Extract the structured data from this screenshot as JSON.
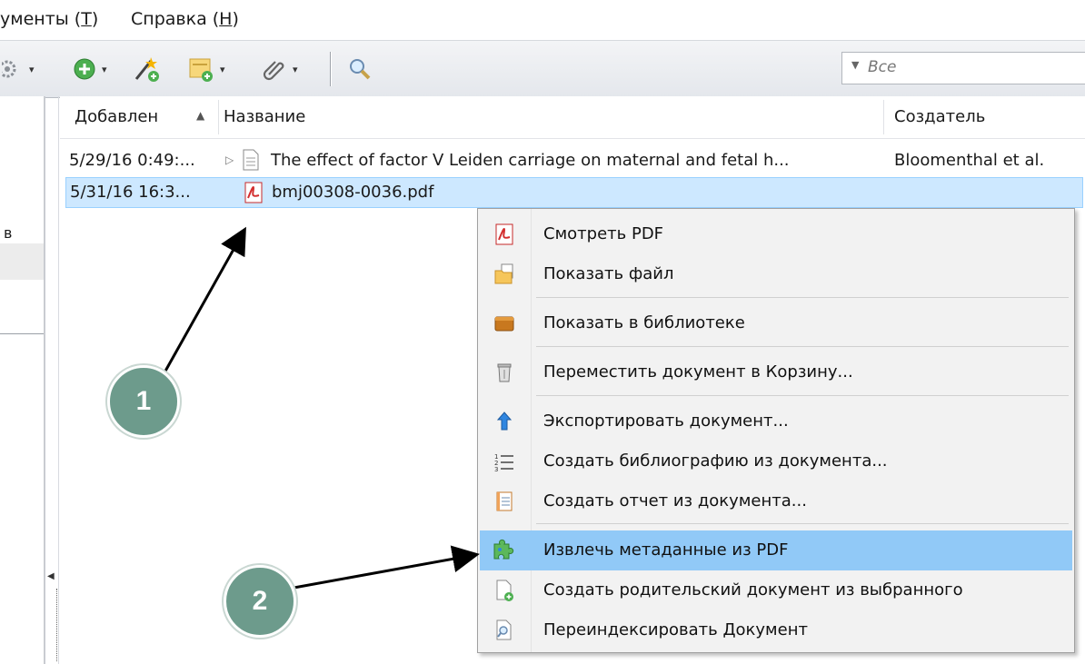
{
  "menubar": {
    "items": [
      {
        "pre": "ументы (",
        "key": "Т",
        "post": ")"
      },
      {
        "pre": "Справка (",
        "key": "Н",
        "post": ")"
      }
    ]
  },
  "toolbar": {
    "search_placeholder": "Все"
  },
  "leftpane": {
    "partial_label": "в"
  },
  "table": {
    "columns": {
      "added": "Добавлен",
      "title": "Название",
      "creator": "Создатель"
    },
    "rows": [
      {
        "added": "5/29/16 0:49:...",
        "title": "The effect of factor V Leiden carriage on maternal and fetal h...",
        "creator": "Bloomenthal et al."
      },
      {
        "added": "5/31/16 16:3...",
        "title": "bmj00308-0036.pdf",
        "creator": ""
      }
    ]
  },
  "context_menu": {
    "items": [
      {
        "label": "Смотреть PDF",
        "icon": "pdf-icon"
      },
      {
        "label": "Показать файл",
        "icon": "folder-file-icon"
      },
      {
        "label": "Показать в библиотеке",
        "icon": "library-icon"
      },
      {
        "label": "Переместить документ в Корзину...",
        "icon": "trash-icon"
      },
      {
        "label": "Экспортировать документ...",
        "icon": "export-icon"
      },
      {
        "label": "Создать библиографию из документа...",
        "icon": "bibliography-icon"
      },
      {
        "label": "Создать отчет из документа...",
        "icon": "report-icon"
      },
      {
        "label": "Извлечь метаданные из PDF",
        "icon": "puzzle-icon"
      },
      {
        "label": "Создать родительский документ из выбранного",
        "icon": "new-parent-icon"
      },
      {
        "label": "Переиндексировать Документ",
        "icon": "reindex-icon"
      }
    ],
    "highlighted_index": 7
  },
  "callouts": [
    "1",
    "2"
  ],
  "colors": {
    "selection": "#cde8ff",
    "menu_highlight": "#91c9f7",
    "callout": "#6d9b8c"
  }
}
